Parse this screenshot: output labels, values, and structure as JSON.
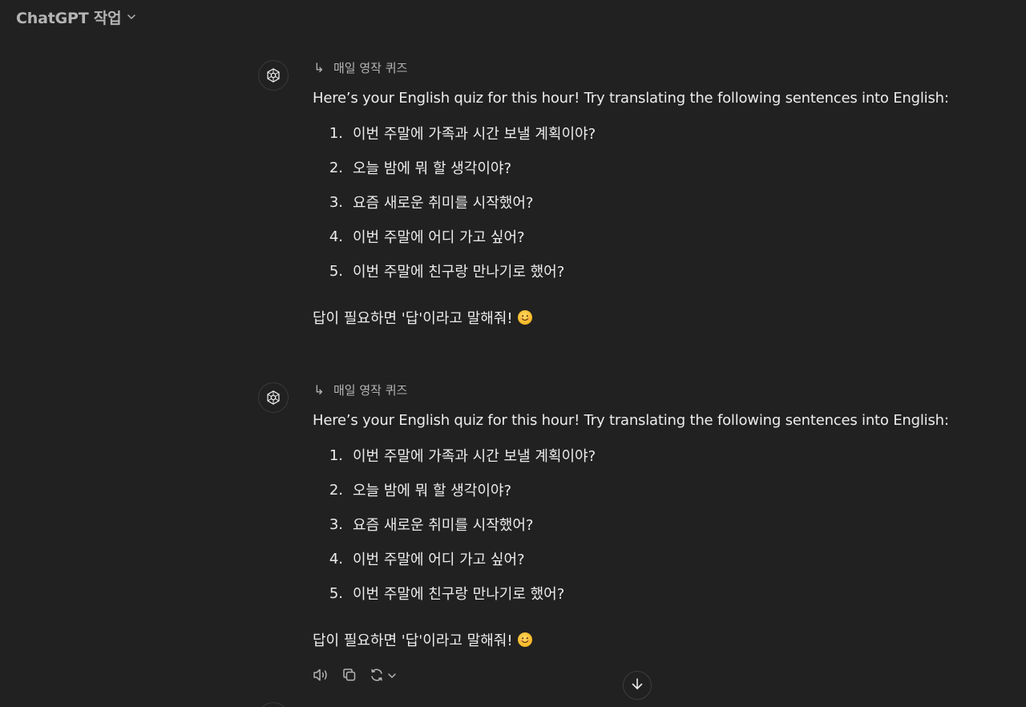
{
  "header": {
    "title": "ChatGPT 작업"
  },
  "messages": [
    {
      "task_label": "매일 영작 퀴즈",
      "intro": "Here’s your English quiz for this hour! Try translating the following sentences into English:",
      "items": [
        {
          "num": "1.",
          "text": "이번 주말에 가족과 시간 보낼 계획이야?"
        },
        {
          "num": "2.",
          "text": "오늘 밤에 뭐 할 생각이야?"
        },
        {
          "num": "3.",
          "text": "요즘 새로운 취미를 시작했어?"
        },
        {
          "num": "4.",
          "text": "이번 주말에 어디 가고 싶어?"
        },
        {
          "num": "5.",
          "text": "이번 주말에 친구랑 만나기로 했어?"
        }
      ],
      "footer": "답이 필요하면 '답'이라고 말해줘!"
    },
    {
      "task_label": "매일 영작 퀴즈",
      "intro": "Here’s your English quiz for this hour! Try translating the following sentences into English:",
      "items": [
        {
          "num": "1.",
          "text": "이번 주말에 가족과 시간 보낼 계획이야?"
        },
        {
          "num": "2.",
          "text": "오늘 밤에 뭐 할 생각이야?"
        },
        {
          "num": "3.",
          "text": "요즘 새로운 취미를 시작했어?"
        },
        {
          "num": "4.",
          "text": "이번 주말에 어디 가고 싶어?"
        },
        {
          "num": "5.",
          "text": "이번 주말에 친구랑 만나기로 했어?"
        }
      ],
      "footer": "답이 필요하면 '답'이라고 말해줘!"
    }
  ],
  "icons": {
    "header_chevron": "chevron-down-icon",
    "avatar": "openai-logo-icon",
    "task_ref": "return-arrow-icon",
    "emoji": "smiling-face-emoji",
    "read_aloud": "speaker-icon",
    "copy": "copy-icon",
    "regenerate": "refresh-icon",
    "scroll": "arrow-down-icon"
  },
  "colors": {
    "background": "#212121",
    "text": "#ececec",
    "muted": "#b4b4b4",
    "border": "#3a3a3a"
  }
}
